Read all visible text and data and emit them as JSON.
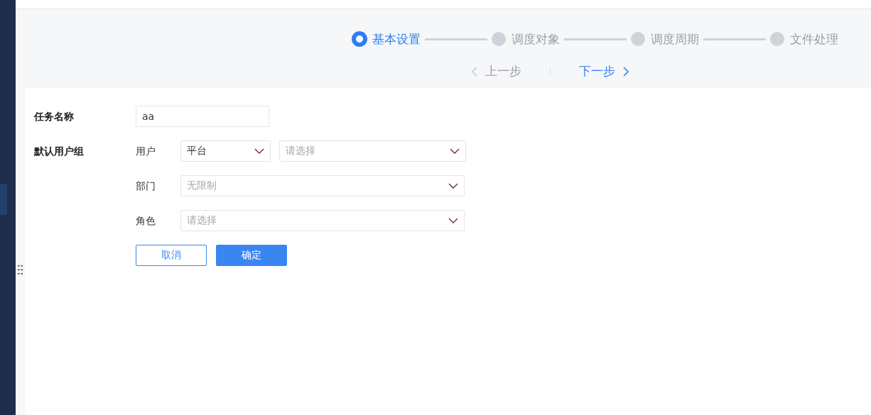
{
  "steps": [
    {
      "label": "基本设置",
      "selected": true
    },
    {
      "label": "调度对象",
      "selected": false
    },
    {
      "label": "调度周期",
      "selected": false
    },
    {
      "label": "文件处理",
      "selected": false
    }
  ],
  "nav": {
    "prev": {
      "label": "上一步",
      "disabled": true
    },
    "next": {
      "label": "下一步",
      "disabled": false
    }
  },
  "form": {
    "task_name": {
      "label": "任务名称",
      "value": "aa"
    },
    "user_group": {
      "label": "默认用户组",
      "rows": [
        {
          "label": "用户",
          "selects": [
            {
              "value": "平台"
            },
            {
              "placeholder": "请选择"
            }
          ]
        },
        {
          "label": "部门",
          "selects": [
            {
              "placeholder": "无限制"
            }
          ]
        },
        {
          "label": "角色",
          "selects": [
            {
              "placeholder": "请选择"
            }
          ]
        }
      ]
    },
    "buttons": [
      {
        "label": "取消",
        "kind": "secondary"
      },
      {
        "label": "确定",
        "kind": "primary"
      }
    ]
  }
}
